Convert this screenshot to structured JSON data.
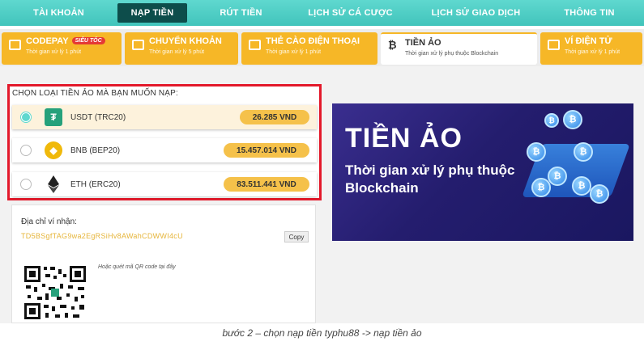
{
  "nav": {
    "items": [
      {
        "label": "TÀI KHOẢN"
      },
      {
        "label": "NẠP TIỀN"
      },
      {
        "label": "RÚT TIỀN"
      },
      {
        "label": "LỊCH SỬ CÁ CƯỢC"
      },
      {
        "label": "LỊCH SỬ GIAO DỊCH"
      },
      {
        "label": "THÔNG TIN"
      }
    ],
    "active": "NẠP TIỀN"
  },
  "tabs": [
    {
      "title": "CODEPAY",
      "badge": "SIÊU TỐC",
      "subtitle": "Thời gian xử lý 1 phút"
    },
    {
      "title": "CHUYỂN KHOẢN",
      "subtitle": "Thời gian xử lý 5 phút"
    },
    {
      "title": "THẺ CÀO ĐIỆN THOẠI",
      "subtitle": "Thời gian xử lý 1 phút"
    },
    {
      "title": "TIỀN ẢO",
      "subtitle": "Thời gian xử lý phụ thuộc Blockchain",
      "icon": "bitcoin-icon"
    },
    {
      "title": "VÍ ĐIỆN TỬ",
      "subtitle": "Thời gian xử lý 1 phút"
    }
  ],
  "crypto": {
    "prompt": "CHỌN LOẠI TIỀN ẢO MÀ BẠN MUỐN NẠP:",
    "options": [
      {
        "name": "USDT (TRC20)",
        "amount": "26.285 VND",
        "selected": true,
        "icon": "tether-icon"
      },
      {
        "name": "BNB (BEP20)",
        "amount": "15.457.014 VND",
        "selected": false,
        "icon": "bnb-icon"
      },
      {
        "name": "ETH (ERC20)",
        "amount": "83.511.441 VND",
        "selected": false,
        "icon": "ethereum-icon"
      }
    ]
  },
  "wallet": {
    "label": "Địa chỉ ví nhận:",
    "address": "TD5BSgfTAG9wa2EgRSiHv8AWahCDWWI4cU",
    "copy_label": "Copy",
    "qr_hint": "Hoặc quét mã QR code tại đây"
  },
  "banner": {
    "title": "TIỀN ẢO",
    "subtitle": "Thời gian xử lý phụ thuộc Blockchain"
  },
  "caption": "bước 2 – chọn nạp tiền typhu88 -> nạp tiền ảo",
  "colors": {
    "nav": "#41c4bb",
    "tab": "#f6b727",
    "highlight": "#e3192b",
    "amount": "#f5c14a"
  }
}
